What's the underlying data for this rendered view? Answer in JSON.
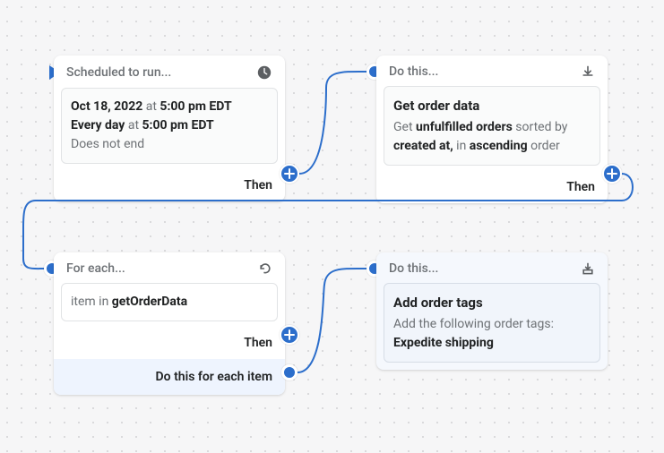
{
  "colors": {
    "accent": "#2c6ecb"
  },
  "card1": {
    "title": "Scheduled to run...",
    "line1_date": "Oct 18, 2022",
    "line1_at": " at ",
    "line1_time": "5:00 pm EDT",
    "line2_every": "Every day",
    "line2_at": " at ",
    "line2_time": "5:00 pm EDT",
    "line3": "Does not end",
    "footer": "Then"
  },
  "card2": {
    "title": "Do this...",
    "body_title": "Get order data",
    "seg1": "Get ",
    "seg2": "unfulfilled orders",
    "seg3": " sorted by ",
    "seg4": "created at,",
    "seg5": " in ",
    "seg6": "ascending",
    "seg7": " order",
    "footer": "Then"
  },
  "card3": {
    "title": "For each...",
    "prefix": "item in ",
    "var": "getOrderData",
    "footer": "Then",
    "each_footer": "Do this for each item"
  },
  "card4": {
    "title": "Do this...",
    "body_title": "Add order tags",
    "sub": "Add the following order tags:",
    "tag": "Expedite shipping"
  }
}
